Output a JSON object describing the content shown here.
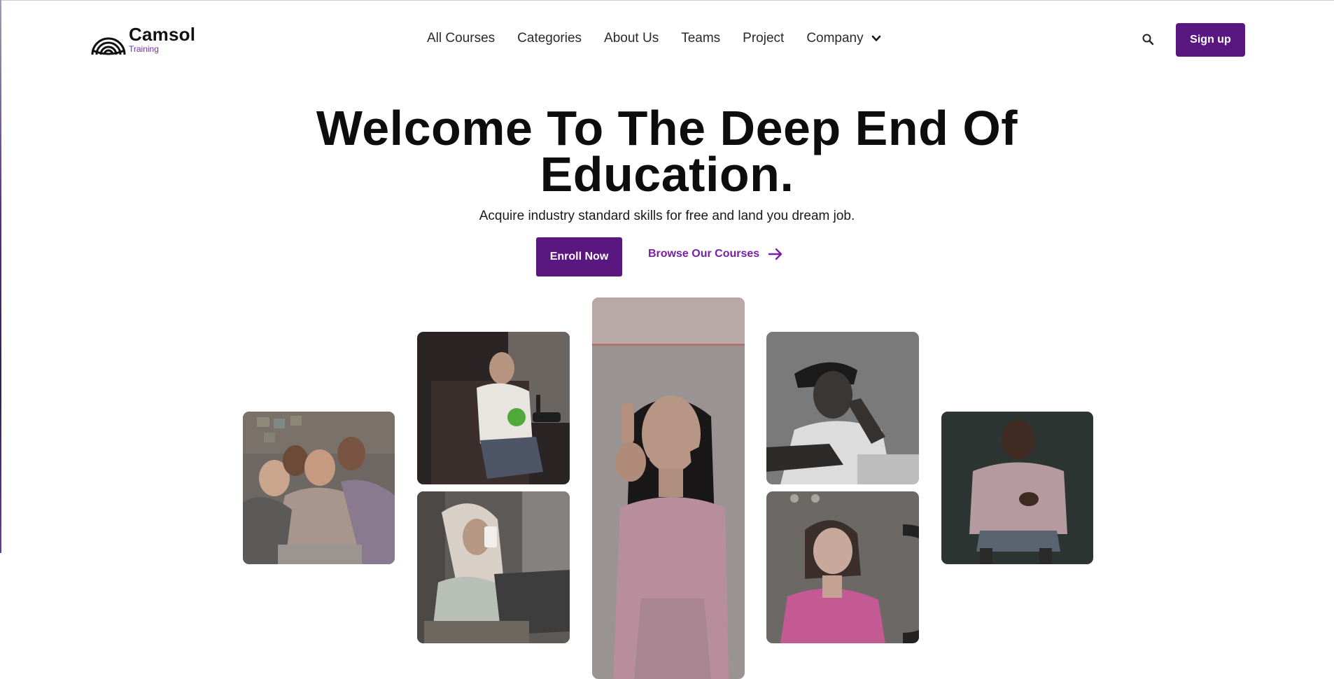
{
  "header": {
    "brand": "Camsol",
    "brand_sub": "Training",
    "nav": [
      "All Courses",
      "Categories",
      "About Us",
      "Teams",
      "Project",
      "Company"
    ],
    "signup_label": "Sign up"
  },
  "hero": {
    "title_line1": "Welcome To The Deep End Of",
    "title_line2": "Education.",
    "subtitle": "Acquire industry standard skills for free and land you dream job.",
    "enroll_label": "Enroll Now",
    "browse_label": "Browse Our Courses"
  },
  "colors": {
    "primary": "#5b1780",
    "link": "#7b1fa2",
    "text": "#0d0d0d"
  },
  "icons": [
    "logo-icon",
    "search-icon",
    "chevron-down-icon",
    "arrow-right-icon"
  ]
}
